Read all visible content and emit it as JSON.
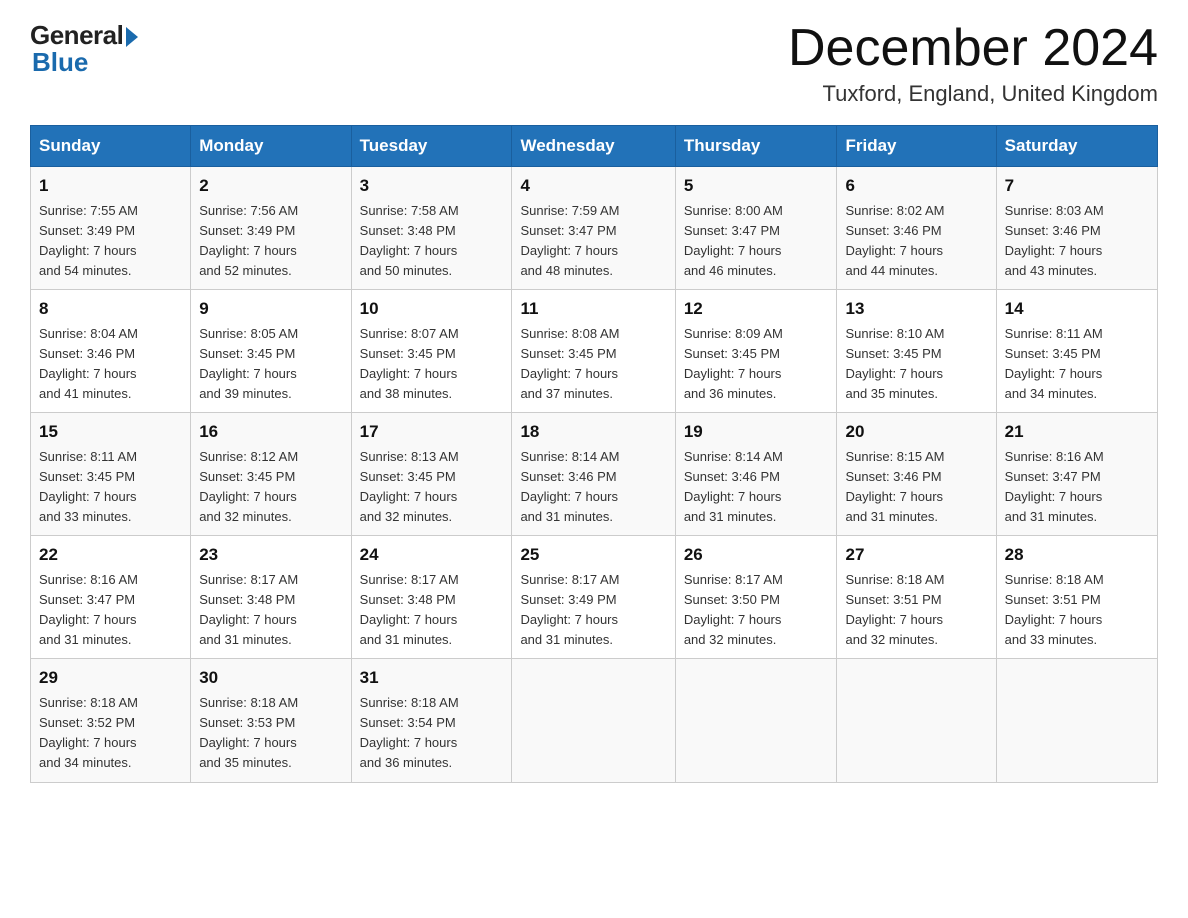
{
  "header": {
    "logo_general": "General",
    "logo_blue": "Blue",
    "month_title": "December 2024",
    "location": "Tuxford, England, United Kingdom"
  },
  "calendar": {
    "days_of_week": [
      "Sunday",
      "Monday",
      "Tuesday",
      "Wednesday",
      "Thursday",
      "Friday",
      "Saturday"
    ],
    "weeks": [
      [
        {
          "day": "1",
          "info": "Sunrise: 7:55 AM\nSunset: 3:49 PM\nDaylight: 7 hours\nand 54 minutes."
        },
        {
          "day": "2",
          "info": "Sunrise: 7:56 AM\nSunset: 3:49 PM\nDaylight: 7 hours\nand 52 minutes."
        },
        {
          "day": "3",
          "info": "Sunrise: 7:58 AM\nSunset: 3:48 PM\nDaylight: 7 hours\nand 50 minutes."
        },
        {
          "day": "4",
          "info": "Sunrise: 7:59 AM\nSunset: 3:47 PM\nDaylight: 7 hours\nand 48 minutes."
        },
        {
          "day": "5",
          "info": "Sunrise: 8:00 AM\nSunset: 3:47 PM\nDaylight: 7 hours\nand 46 minutes."
        },
        {
          "day": "6",
          "info": "Sunrise: 8:02 AM\nSunset: 3:46 PM\nDaylight: 7 hours\nand 44 minutes."
        },
        {
          "day": "7",
          "info": "Sunrise: 8:03 AM\nSunset: 3:46 PM\nDaylight: 7 hours\nand 43 minutes."
        }
      ],
      [
        {
          "day": "8",
          "info": "Sunrise: 8:04 AM\nSunset: 3:46 PM\nDaylight: 7 hours\nand 41 minutes."
        },
        {
          "day": "9",
          "info": "Sunrise: 8:05 AM\nSunset: 3:45 PM\nDaylight: 7 hours\nand 39 minutes."
        },
        {
          "day": "10",
          "info": "Sunrise: 8:07 AM\nSunset: 3:45 PM\nDaylight: 7 hours\nand 38 minutes."
        },
        {
          "day": "11",
          "info": "Sunrise: 8:08 AM\nSunset: 3:45 PM\nDaylight: 7 hours\nand 37 minutes."
        },
        {
          "day": "12",
          "info": "Sunrise: 8:09 AM\nSunset: 3:45 PM\nDaylight: 7 hours\nand 36 minutes."
        },
        {
          "day": "13",
          "info": "Sunrise: 8:10 AM\nSunset: 3:45 PM\nDaylight: 7 hours\nand 35 minutes."
        },
        {
          "day": "14",
          "info": "Sunrise: 8:11 AM\nSunset: 3:45 PM\nDaylight: 7 hours\nand 34 minutes."
        }
      ],
      [
        {
          "day": "15",
          "info": "Sunrise: 8:11 AM\nSunset: 3:45 PM\nDaylight: 7 hours\nand 33 minutes."
        },
        {
          "day": "16",
          "info": "Sunrise: 8:12 AM\nSunset: 3:45 PM\nDaylight: 7 hours\nand 32 minutes."
        },
        {
          "day": "17",
          "info": "Sunrise: 8:13 AM\nSunset: 3:45 PM\nDaylight: 7 hours\nand 32 minutes."
        },
        {
          "day": "18",
          "info": "Sunrise: 8:14 AM\nSunset: 3:46 PM\nDaylight: 7 hours\nand 31 minutes."
        },
        {
          "day": "19",
          "info": "Sunrise: 8:14 AM\nSunset: 3:46 PM\nDaylight: 7 hours\nand 31 minutes."
        },
        {
          "day": "20",
          "info": "Sunrise: 8:15 AM\nSunset: 3:46 PM\nDaylight: 7 hours\nand 31 minutes."
        },
        {
          "day": "21",
          "info": "Sunrise: 8:16 AM\nSunset: 3:47 PM\nDaylight: 7 hours\nand 31 minutes."
        }
      ],
      [
        {
          "day": "22",
          "info": "Sunrise: 8:16 AM\nSunset: 3:47 PM\nDaylight: 7 hours\nand 31 minutes."
        },
        {
          "day": "23",
          "info": "Sunrise: 8:17 AM\nSunset: 3:48 PM\nDaylight: 7 hours\nand 31 minutes."
        },
        {
          "day": "24",
          "info": "Sunrise: 8:17 AM\nSunset: 3:48 PM\nDaylight: 7 hours\nand 31 minutes."
        },
        {
          "day": "25",
          "info": "Sunrise: 8:17 AM\nSunset: 3:49 PM\nDaylight: 7 hours\nand 31 minutes."
        },
        {
          "day": "26",
          "info": "Sunrise: 8:17 AM\nSunset: 3:50 PM\nDaylight: 7 hours\nand 32 minutes."
        },
        {
          "day": "27",
          "info": "Sunrise: 8:18 AM\nSunset: 3:51 PM\nDaylight: 7 hours\nand 32 minutes."
        },
        {
          "day": "28",
          "info": "Sunrise: 8:18 AM\nSunset: 3:51 PM\nDaylight: 7 hours\nand 33 minutes."
        }
      ],
      [
        {
          "day": "29",
          "info": "Sunrise: 8:18 AM\nSunset: 3:52 PM\nDaylight: 7 hours\nand 34 minutes."
        },
        {
          "day": "30",
          "info": "Sunrise: 8:18 AM\nSunset: 3:53 PM\nDaylight: 7 hours\nand 35 minutes."
        },
        {
          "day": "31",
          "info": "Sunrise: 8:18 AM\nSunset: 3:54 PM\nDaylight: 7 hours\nand 36 minutes."
        },
        {
          "day": "",
          "info": ""
        },
        {
          "day": "",
          "info": ""
        },
        {
          "day": "",
          "info": ""
        },
        {
          "day": "",
          "info": ""
        }
      ]
    ]
  }
}
